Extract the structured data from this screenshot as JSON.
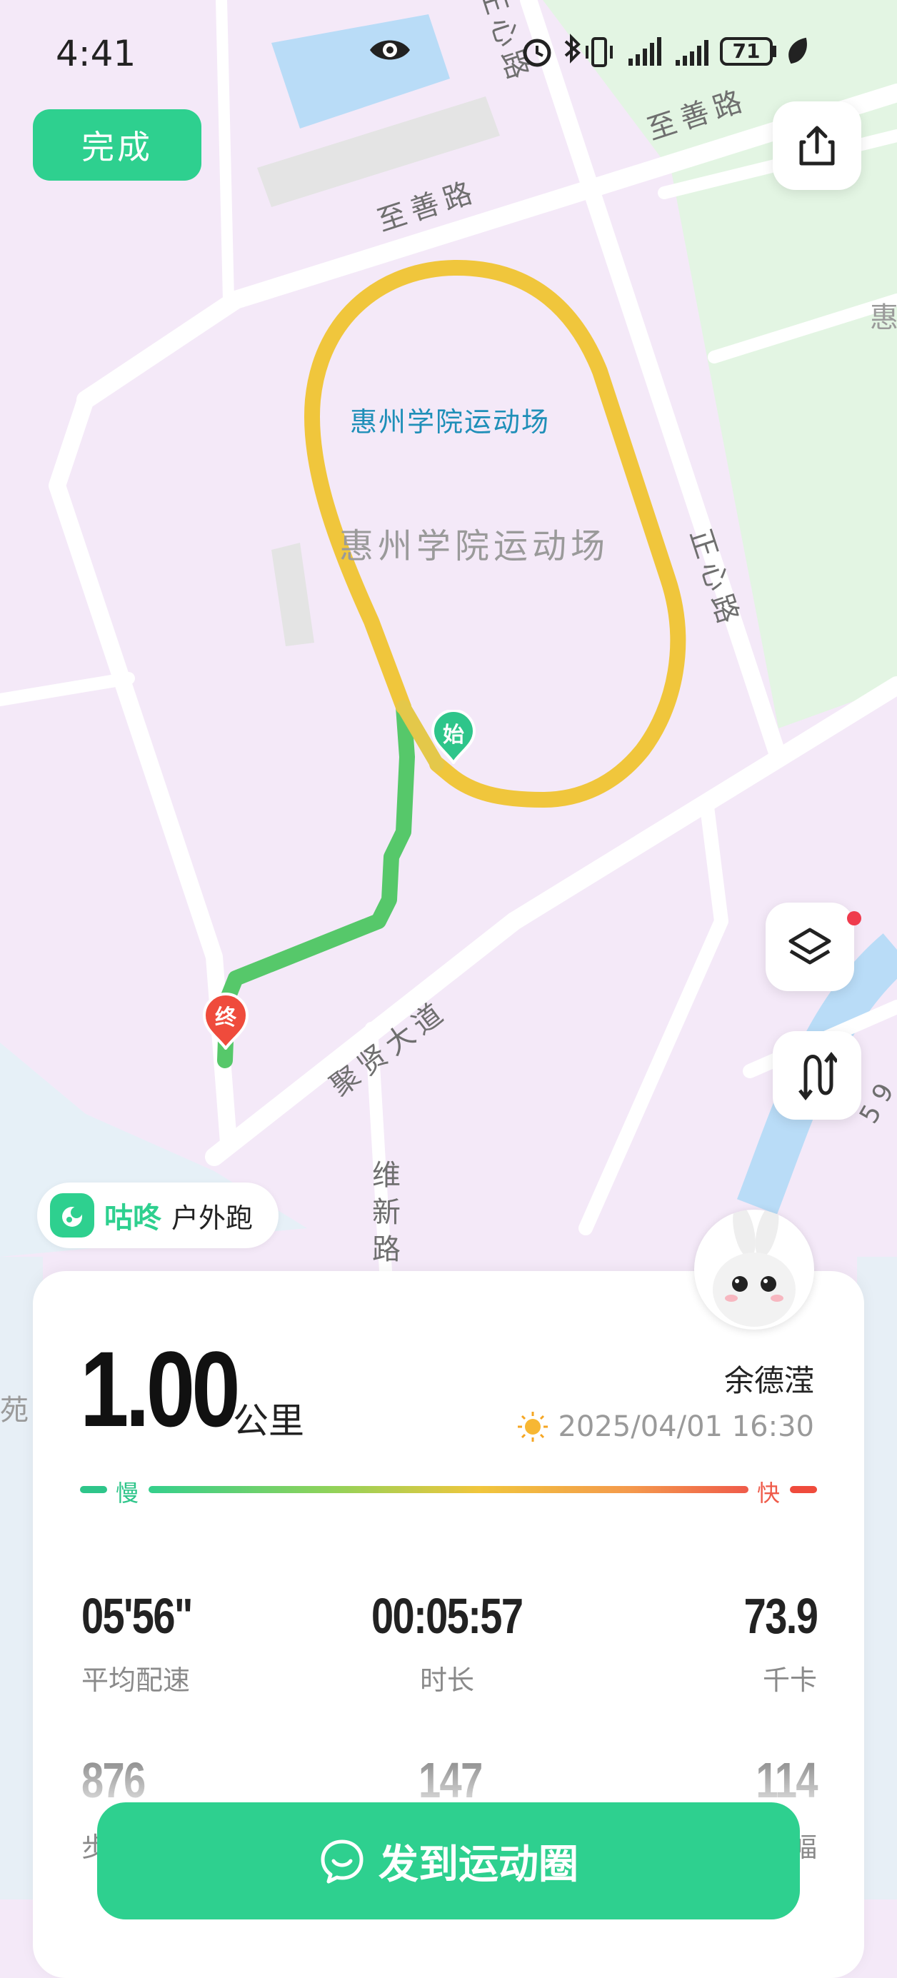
{
  "status_bar": {
    "time": "4:41",
    "battery": "71"
  },
  "top": {
    "done_label": "完成"
  },
  "map": {
    "labels": {
      "road_zhishan_1": "至善路",
      "road_zhishan_2": "至善路",
      "road_zhengxin_top": "正心路",
      "road_zhengxin": "正心路",
      "road_juxian": "聚贤大道",
      "road_weixin": "维新路",
      "stadium_label": "惠州学院运动场",
      "stadium_label_map": "惠州学院运动场",
      "edge_hui": "惠",
      "edge_yuan": "苑",
      "edge_59": "5 9"
    },
    "start_marker": "始",
    "end_marker": "终",
    "route_colors": {
      "fast": "#f0c63c",
      "slow": "#34c76e"
    }
  },
  "brand": {
    "name": "咕咚",
    "activity_type": "户外跑"
  },
  "summary": {
    "distance": "1.00",
    "distance_unit": "公里",
    "user_name": "余德滢",
    "datetime": "2025/04/01 16:30",
    "weather_icon": "sun-icon",
    "speed_slow_label": "慢",
    "speed_fast_label": "快"
  },
  "stats": {
    "avg_pace": {
      "value": "05'56\"",
      "label": "平均配速"
    },
    "duration": {
      "value": "00:05:57",
      "label": "时长"
    },
    "calories": {
      "value": "73.9",
      "label": "千卡"
    },
    "steps": {
      "value": "876",
      "label": "步"
    },
    "cadence": {
      "value": "147",
      "label": ""
    },
    "stride": {
      "value": "114",
      "label": "幅"
    }
  },
  "actions": {
    "post_label": "发到运动圈"
  },
  "colors": {
    "accent": "#2ed08f",
    "route_yellow": "#f0c63c",
    "map_bg": "#f4e9f8",
    "park_green": "#e3f5e3",
    "water": "#b9dcf7"
  }
}
